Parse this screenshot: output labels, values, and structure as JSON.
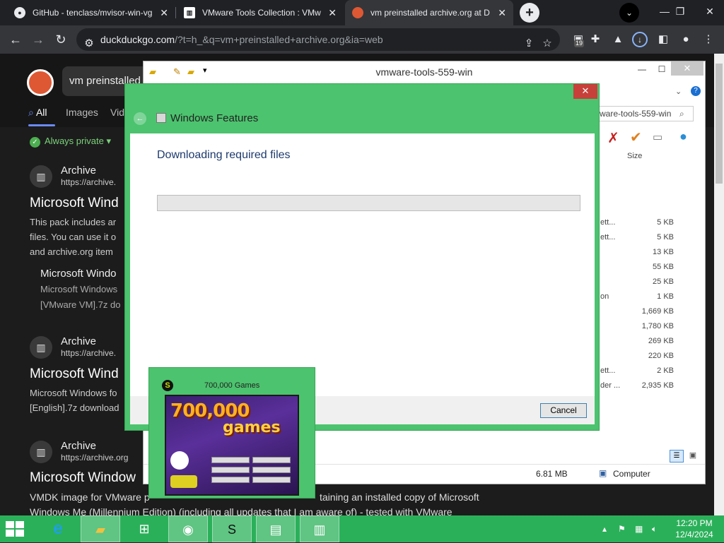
{
  "browser": {
    "tabs": [
      {
        "title": "GitHub - tenclass/mvisor-win-vg",
        "icon": "github-icon"
      },
      {
        "title": "VMware Tools Collection : VMw",
        "icon": "archive-icon"
      },
      {
        "title": "vm preinstalled archive.org at D",
        "icon": "duckduckgo-icon"
      }
    ],
    "url_host": "duckduckgo.com",
    "url_path": "/?t=h_&q=vm+preinstalled+archive.org&ia=web",
    "extension_badge": "19"
  },
  "ddg": {
    "search_value": "vm preinstalled",
    "tabs": [
      "All",
      "Images",
      "Vid"
    ],
    "private_label": "Always private",
    "results": [
      {
        "site": "Archive",
        "url": "https://archive.",
        "title": "Microsoft Wind",
        "snippet": [
          "This pack includes ar",
          "files. You can use it o",
          "and archive.org item"
        ],
        "sub_title": "Microsoft Windo",
        "sub_snippet": [
          "Microsoft Windows",
          "[VMware VM].7z do"
        ]
      },
      {
        "site": "Archive",
        "url": "https://archive.",
        "title": "Microsoft Wind",
        "snippet": [
          "Microsoft Windows fo",
          "[English].7z download"
        ]
      },
      {
        "site": "Archive",
        "url": "https://archive.org",
        "title": "Microsoft Window",
        "snippet": [
          "VMDK image for VMware p",
          "Windows Me (Millennium Edition) (including all updates that I am aware of) - tested with VMware"
        ],
        "snippet_tail": "taining an installed copy of Microsoft"
      }
    ]
  },
  "explorer": {
    "title": "vmware-tools-559-win",
    "search_text": "ware-tools-559-win",
    "size_header": "Size",
    "rows": [
      {
        "partial": "ett...",
        "size": "5 KB"
      },
      {
        "partial": "ett...",
        "size": "5 KB"
      },
      {
        "partial": "",
        "size": "13 KB"
      },
      {
        "partial": "",
        "size": "55 KB"
      },
      {
        "partial": "",
        "size": "25 KB"
      },
      {
        "partial": "on",
        "size": "1 KB"
      },
      {
        "partial": "",
        "size": "1,669 KB"
      },
      {
        "partial": "",
        "size": "1,780 KB"
      },
      {
        "partial": "",
        "size": "269 KB"
      },
      {
        "partial": "",
        "size": "220 KB"
      },
      {
        "partial": "ett...",
        "size": "2 KB"
      },
      {
        "partial": "der ...",
        "size": "2,935 KB"
      }
    ],
    "status_size": "6.81 MB",
    "status_location": "Computer"
  },
  "features_dialog": {
    "title": "Windows Features",
    "heading": "Downloading required files",
    "progress_fraction": 0,
    "cancel_label": "Cancel"
  },
  "games_window": {
    "title": "700,000 Games",
    "art_line1": "700,000",
    "art_line2": "games"
  },
  "taskbar": {
    "time": "12:20 PM",
    "date": "12/4/2024"
  }
}
